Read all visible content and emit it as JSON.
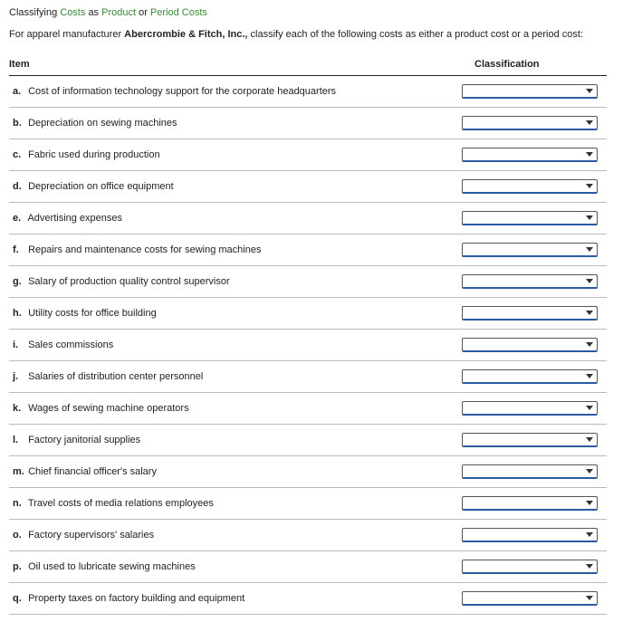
{
  "title": {
    "t1": "Classifying",
    "t2": "Costs",
    "t3": "as",
    "t4": "Product",
    "t5": "or",
    "t6": "Period Costs"
  },
  "instruction": {
    "pre": "For apparel manufacturer ",
    "bold": "Abercrombie & Fitch, Inc.,",
    "post": " classify each of the following costs as either a product cost or a period cost:"
  },
  "header": {
    "item": "Item",
    "classification": "Classification"
  },
  "rows": [
    {
      "marker": "a.",
      "text": "Cost of information technology support for the corporate headquarters"
    },
    {
      "marker": "b.",
      "text": "Depreciation on sewing machines"
    },
    {
      "marker": "c.",
      "text": "Fabric used during production"
    },
    {
      "marker": "d.",
      "text": "Depreciation on office equipment"
    },
    {
      "marker": "e.",
      "text": "Advertising expenses"
    },
    {
      "marker": "f.",
      "text": "Repairs and maintenance costs for sewing machines"
    },
    {
      "marker": "g.",
      "text": "Salary of production quality control supervisor"
    },
    {
      "marker": "h.",
      "text": "Utility costs for office building"
    },
    {
      "marker": "i.",
      "text": "Sales commissions"
    },
    {
      "marker": "j.",
      "text": "Salaries of distribution center personnel"
    },
    {
      "marker": "k.",
      "text": "Wages of sewing machine operators"
    },
    {
      "marker": "l.",
      "text": "Factory janitorial supplies"
    },
    {
      "marker": "m.",
      "text": "Chief financial officer's salary"
    },
    {
      "marker": "n.",
      "text": "Travel costs of media relations employees"
    },
    {
      "marker": "o.",
      "text": "Factory supervisors' salaries"
    },
    {
      "marker": "p.",
      "text": "Oil used to lubricate sewing machines"
    },
    {
      "marker": "q.",
      "text": "Property taxes on factory building and equipment"
    }
  ]
}
